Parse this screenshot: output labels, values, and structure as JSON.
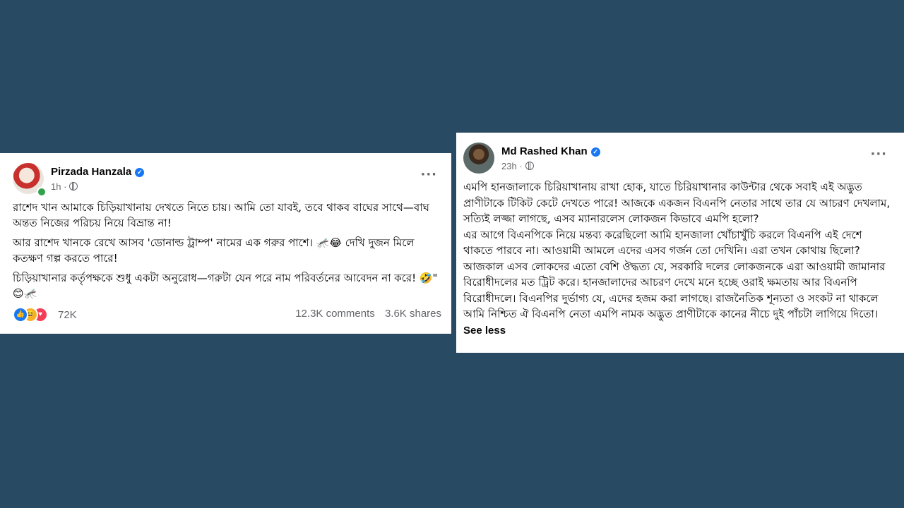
{
  "background_color": "#284a62",
  "post_left": {
    "author": "Pirzada Hanzala",
    "time": "1h",
    "paragraphs": [
      "রাশেদ খান আমাকে চিড়িয়াখানায় দেখতে নিতে চায়। আমি তো যাবই, তবে থাকব বাঘের সাথে—বাঘ অন্তত নিজের পরিচয় নিয়ে বিভ্রান্ত না!",
      "আর রাশেদ খানকে রেখে আসব 'ডোনাল্ড ট্রাম্প' নামের এক গরুর পাশে। 🦟😂 দেখি দুজন মিলে কতক্ষণ গল্প করতে পারে!",
      "চিড়িয়াখানার কর্তৃপক্ষকে শুধু একটা অনুরোধ—গরুটা যেন পরে নাম পরিবর্তনের আবেদন না করে! 🤣\" 😊🦟"
    ],
    "reaction_count": "72K",
    "comments": "12.3K comments",
    "shares": "3.6K shares",
    "reaction_icons": [
      "like-icon",
      "haha-icon",
      "love-icon"
    ]
  },
  "post_right": {
    "author": "Md Rashed Khan",
    "time": "23h",
    "paragraphs": [
      "এমপি হানজালাকে চিরিয়াখানায় রাখা হোক, যাতে চিরিয়াখানার কাউন্টার থেকে সবাই এই অদ্ভুত প্রাণীটাকে টিকিট কেটে দেখতে পারে! আজকে একজন বিএনপি নেতার সাথে তার যে আচরণ দেখলাম, সত্যিই লজ্জা লাগছে, এসব ম্যানারলেস লোকজন কিভাবে এমপি হলো?",
      "এর আগে বিএনপিকে নিয়ে মন্তব্য করেছিলো আমি হানজালা খোঁচাখুঁচি করলে বিএনপি এই দেশে থাকতে পারবে না। আওয়ামী আমলে এদের এসব গর্জন তো দেখিনি। এরা তখন কোথায় ছিলো? আজকাল এসব লোকদের এতো বেশি ঔদ্ধত্য যে, সরকারি দলের লোকজনকে এরা আওয়ামী জামানার বিরোধীদলের মত ট্রিট করে। হানজালাদের আচরণ দেখে মনে হচ্ছে ওরাই ক্ষমতায় আর বিএনপি বিরোধীদলে। বিএনপির দুর্ভাগ্য যে, এদের হজম করা লাগছে। রাজনৈতিক শূন্যতা ও সংকট না থাকলে আমি নিশ্চিত ঐ বিএনপি নেতা এমপি নামক অদ্ভুত প্রাণীটাকে কানের নীচে দুই পাঁচটা লাগিয়ে দিতো।"
    ],
    "see_less": "See less"
  },
  "icons": {
    "verified": "verified-badge-icon",
    "globe": "globe-icon",
    "more": "more-options-icon"
  }
}
